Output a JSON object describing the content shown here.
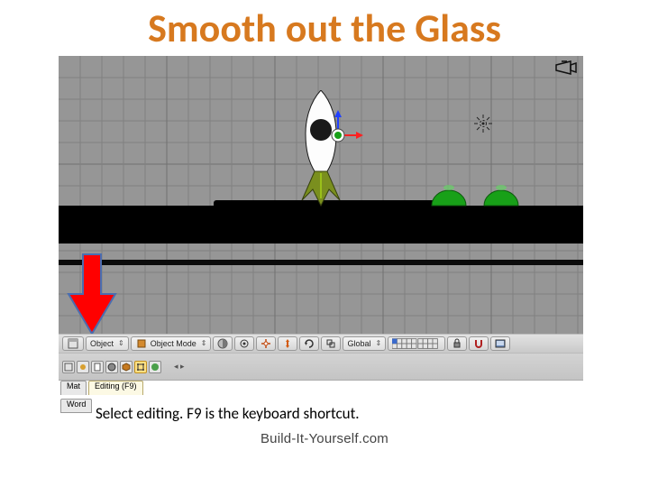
{
  "title": "Smooth out the Glass",
  "caption": "Select editing. F9 is the keyboard shortcut.",
  "footer": "Build-It-Yourself.com",
  "header": {
    "view_label": "Object",
    "mode_label": "Object Mode",
    "mode_updown": "⇕",
    "orientation_label": "Global",
    "orientation_updown": "⇕",
    "icons": {
      "view_menu": "view-menu-icon",
      "shading": "shading-icon",
      "pivot": "pivot-icon",
      "manipulator": "manipulator-icon",
      "translate": "translate-icon",
      "rotate": "rotate-icon",
      "scale": "scale-icon",
      "layers": "layers-icon",
      "lock": "lock-icon",
      "snap": "snap-icon",
      "render": "render-icon"
    }
  },
  "panel": {
    "icons": [
      "context-icon",
      "script-icon",
      "logic-icon",
      "shading-icon",
      "object-icon",
      "edit-icon",
      "scene-icon"
    ],
    "frame_arrows": "◂ ▸"
  },
  "tabs": {
    "mat": "Mat",
    "word": "Word",
    "tooltip": "Editing (F9)"
  },
  "scene": {
    "camera_icon": "camera-icon",
    "lamp_icon": "lamp-icon"
  }
}
